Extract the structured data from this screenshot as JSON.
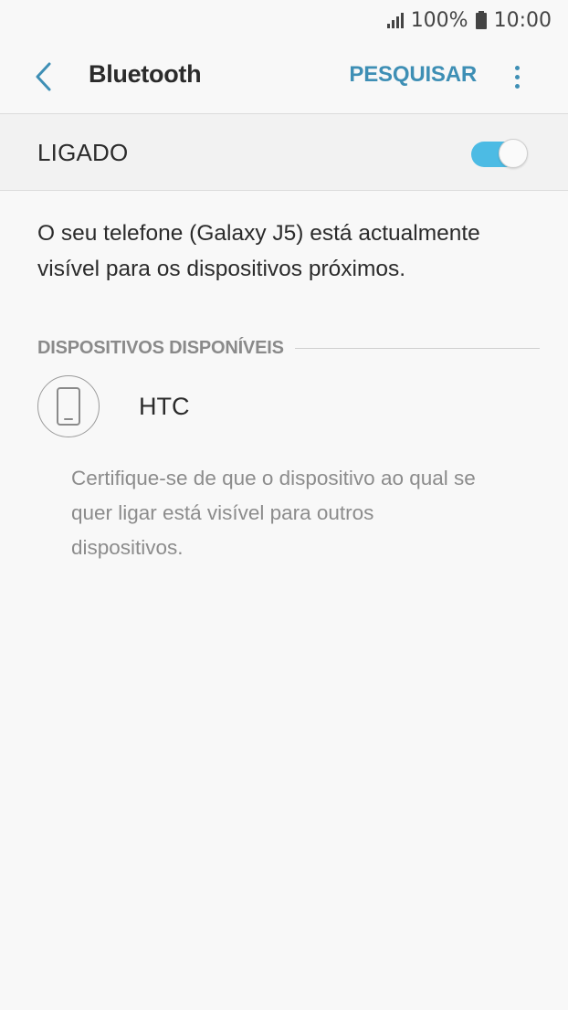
{
  "status_bar": {
    "battery": "100%",
    "time": "10:00",
    "icons": [
      "signal-icon",
      "battery-icon"
    ]
  },
  "app_bar": {
    "title": "Bluetooth",
    "scan_label": "PESQUISAR",
    "back_icon": "chevron-left-icon",
    "more_icon": "more-vert-icon",
    "accent_color": "#3e8fb5"
  },
  "master_switch": {
    "label": "LIGADO",
    "state": "on",
    "toggle_color": "#4cbbe4"
  },
  "visibility_message": "O seu telefone (Galaxy J5) está actualmente visível para os dispositivos próximos.",
  "available_devices": {
    "header": "DISPOSITIVOS DISPONÍVEIS",
    "devices": [
      {
        "name": "HTC",
        "icon": "smartphone-icon"
      }
    ]
  },
  "hint": "Certifique-se de que o dispositivo ao qual se quer ligar está visível para outros dispositivos."
}
